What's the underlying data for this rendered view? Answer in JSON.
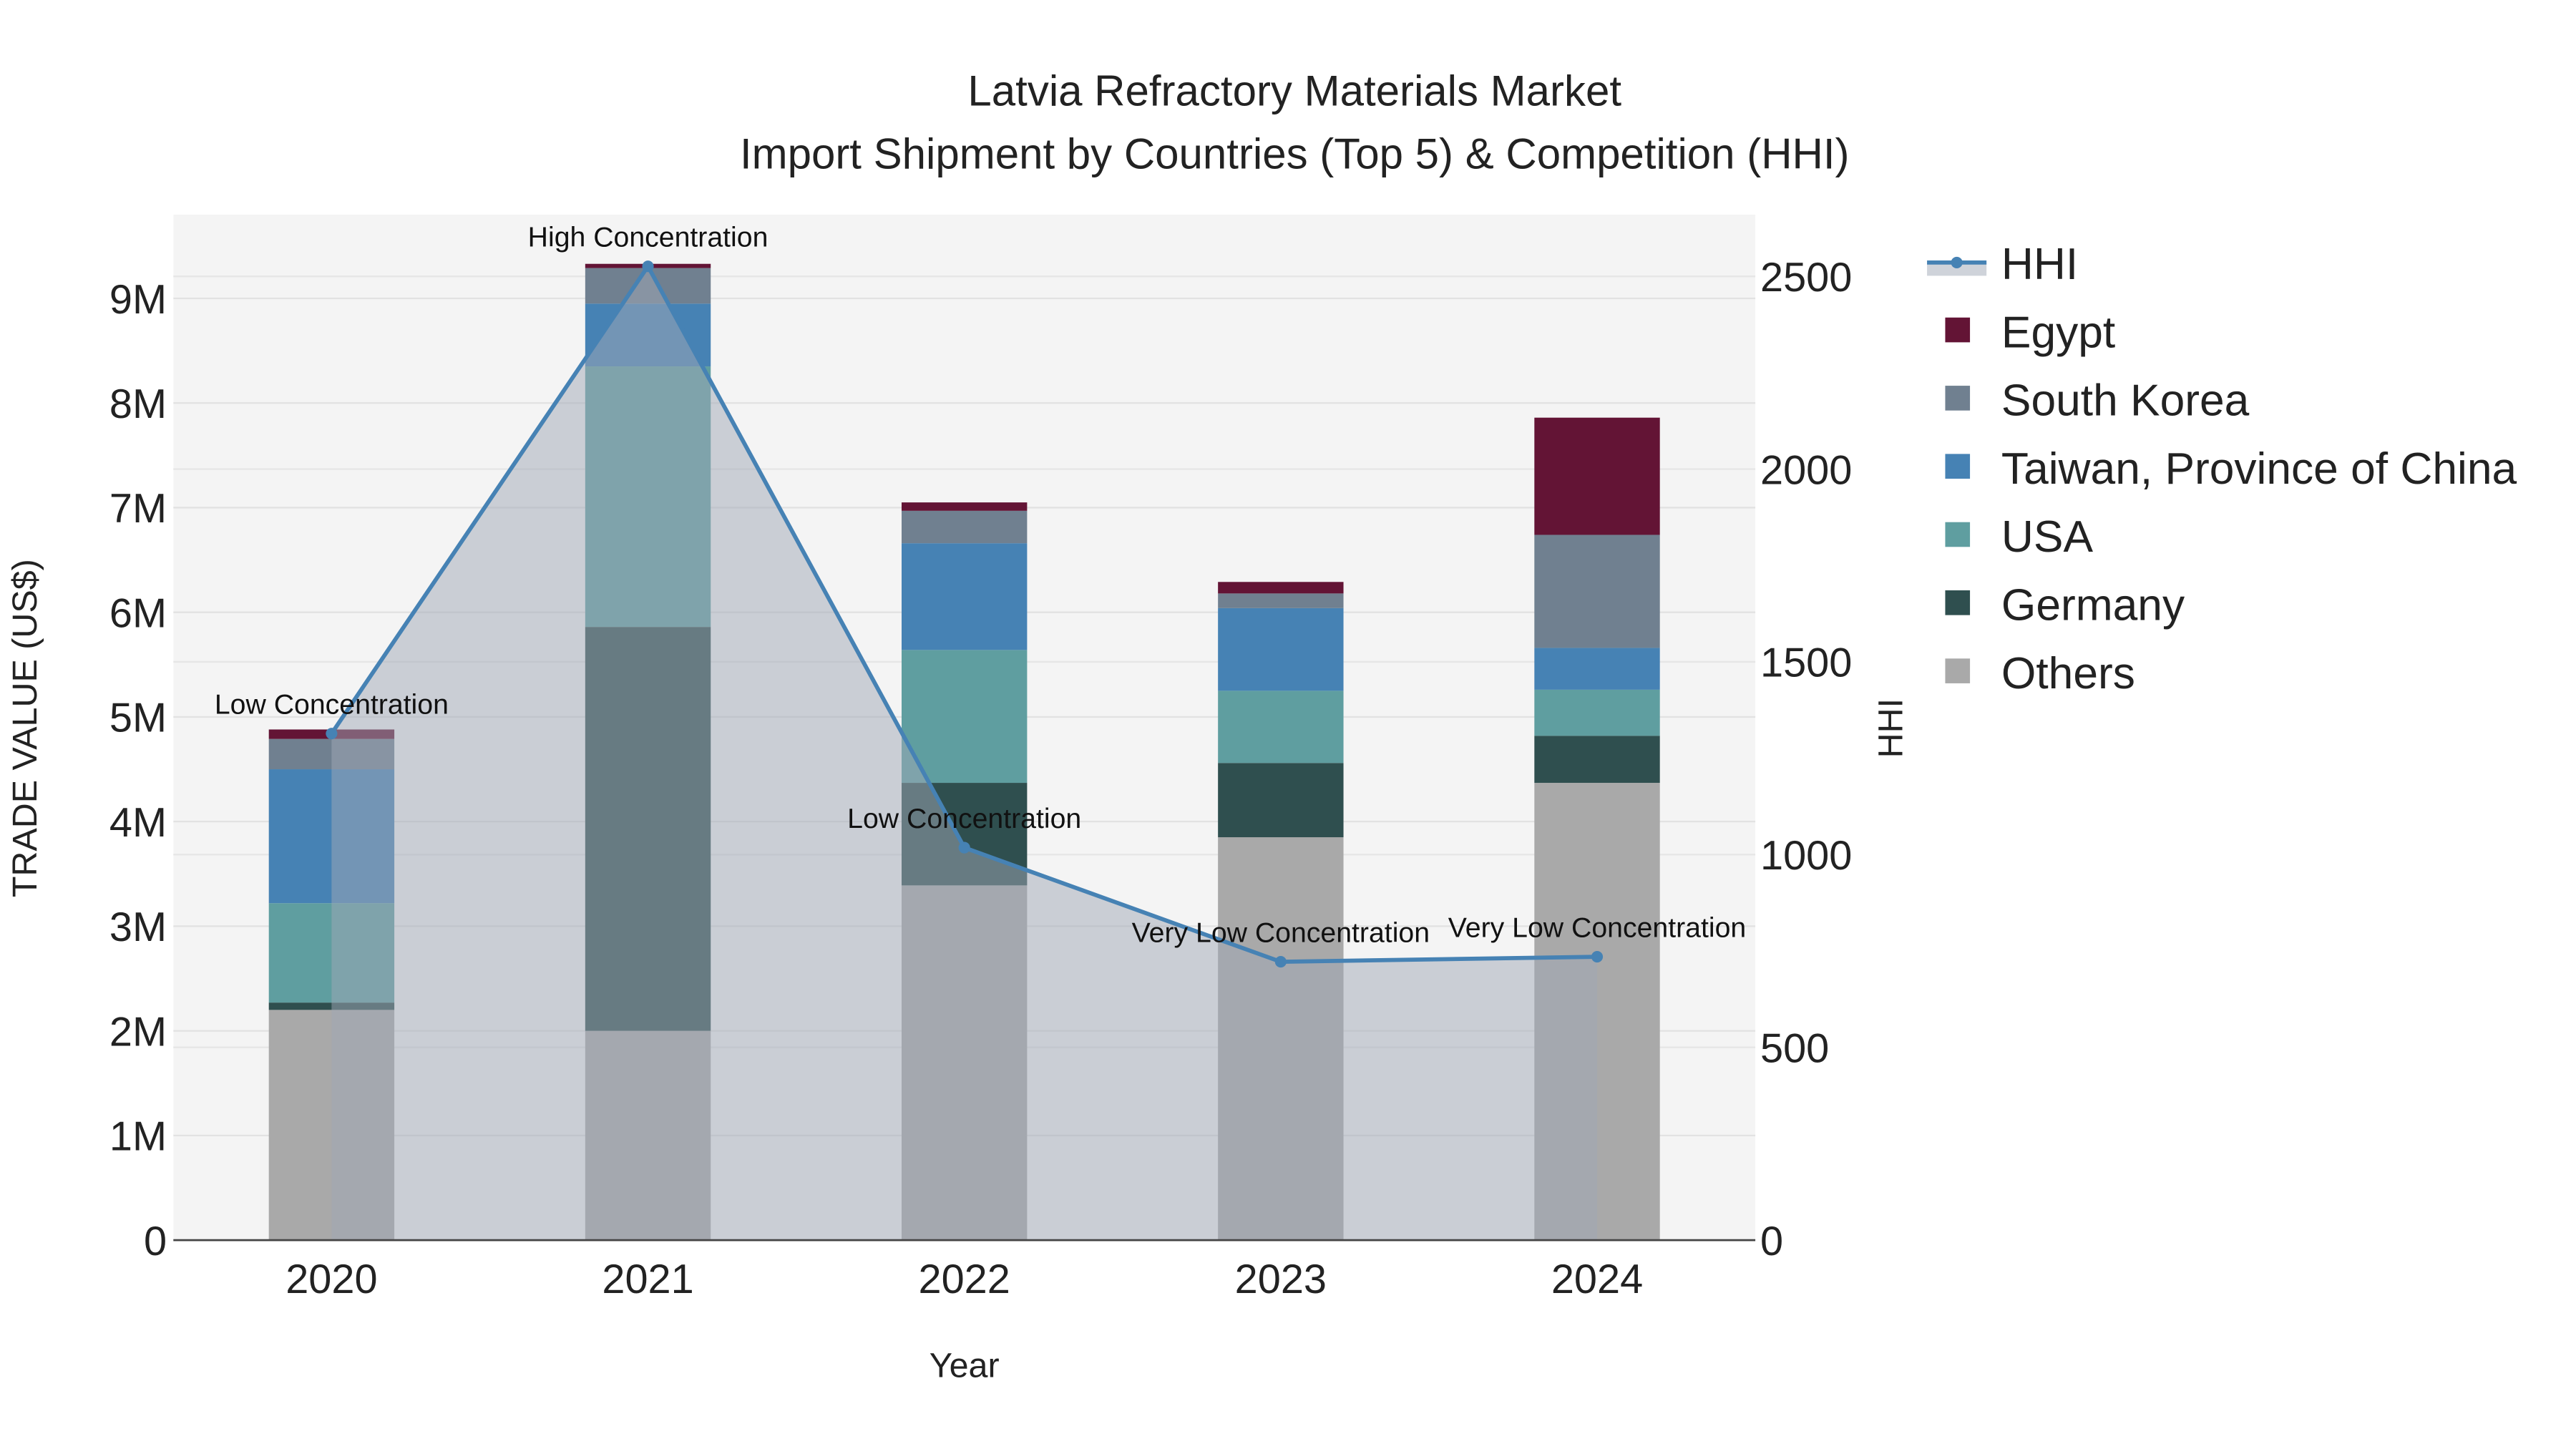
{
  "chart_data": {
    "type": "bar",
    "stacked": true,
    "title": "Latvia Refractory Materials Market",
    "subtitle": "Import Shipment by Countries (Top 5) & Competition (HHI)",
    "xlabel": "Year",
    "ylabel": "TRADE VALUE (US$)",
    "y2label": "HHI",
    "categories": [
      "2020",
      "2021",
      "2022",
      "2023",
      "2024"
    ],
    "ylim": [
      0,
      9800000
    ],
    "y_ticks": [
      0,
      1000000,
      2000000,
      3000000,
      4000000,
      5000000,
      6000000,
      7000000,
      8000000,
      9000000
    ],
    "y_tick_labels": [
      "0",
      "1M",
      "2M",
      "3M",
      "4M",
      "5M",
      "6M",
      "7M",
      "8M",
      "9M"
    ],
    "y2lim": [
      0,
      2660
    ],
    "y2_ticks": [
      0,
      500,
      1000,
      1500,
      2000,
      2500
    ],
    "y2_tick_labels": [
      "0",
      "500",
      "1000",
      "1500",
      "2000",
      "2500"
    ],
    "series": [
      {
        "name": "Others",
        "color": "#A9A9A9",
        "values": [
          2200000,
          2000000,
          3390000,
          3850000,
          4370000
        ]
      },
      {
        "name": "Germany",
        "color": "#2F4F4F",
        "values": [
          70000,
          3860000,
          980000,
          710000,
          450000
        ]
      },
      {
        "name": "USA",
        "color": "#5F9EA0",
        "values": [
          950000,
          2490000,
          1270000,
          690000,
          440000
        ]
      },
      {
        "name": "Taiwan, Province of China",
        "color": "#4682B4",
        "values": [
          1280000,
          600000,
          1020000,
          790000,
          400000
        ]
      },
      {
        "name": "South Korea",
        "color": "#708090",
        "values": [
          290000,
          340000,
          310000,
          140000,
          1080000
        ]
      },
      {
        "name": "Egypt",
        "color": "#631435",
        "values": [
          90000,
          40000,
          80000,
          110000,
          1120000
        ]
      }
    ],
    "hhi": {
      "name": "HHI",
      "color": "#4682B4",
      "values": [
        1314,
        2526,
        1018,
        722,
        735
      ],
      "annotations": [
        "Low Concentration",
        "High Concentration",
        "Low Concentration",
        "Very Low Concentration",
        "Very Low Concentration"
      ]
    },
    "legend": {
      "placement": "right",
      "entries": [
        "HHI",
        "Egypt",
        "South Korea",
        "Taiwan, Province of China",
        "USA",
        "Germany",
        "Others"
      ]
    },
    "grid": true
  }
}
